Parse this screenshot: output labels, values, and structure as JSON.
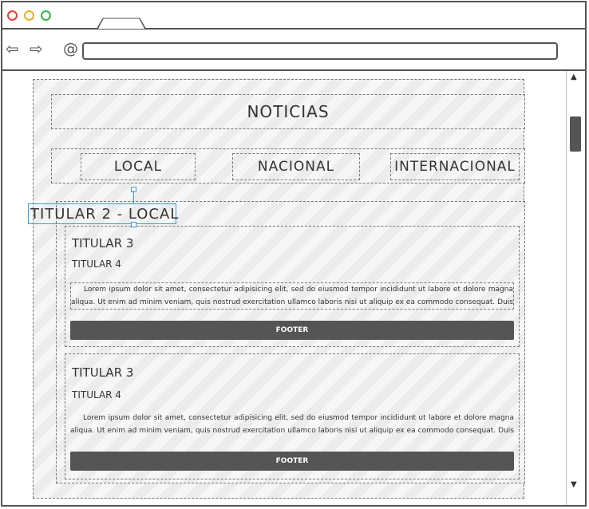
{
  "browser": {
    "dots": [
      "close-dot",
      "minimize-dot",
      "maximize-dot"
    ],
    "dot_colors": [
      "#e8413a",
      "#e6b020",
      "#3bb54a"
    ],
    "nav_back": "⇦",
    "nav_forward": "⇨",
    "reload": "@"
  },
  "page": {
    "header": "NOTICIAS",
    "nav": [
      "LOCAL",
      "NACIONAL",
      "INTERNACIONAL"
    ],
    "section_title": "TITULAR 2 - LOCAL",
    "articles": [
      {
        "h3": "TITULAR 3",
        "h4": "TITULAR 4",
        "paragraph": "Lorem ipsum dolor sit amet, consectetur adipisicing elit, sed do eiusmod tempor incididunt ut labore et dolore magna aliqua. Ut enim ad minim veniam, quis nostrud exercitation ullamco laboris nisi ut aliquip ex ea commodo consequat. Duis aute irure dolor in reprehenderit in voluptate velit esse cillum dolore eu fugiat nulla pariatur.",
        "footer": "FOOTER"
      },
      {
        "h3": "TITULAR 3",
        "h4": "TITULAR 4",
        "paragraph": "Lorem ipsum dolor sit amet, consectetur adipisicing elit, sed do eiusmod tempor incididunt ut labore et dolore magna aliqua. Ut enim ad minim veniam, quis nostrud exercitation ullamco laboris nisi ut aliquip ex ea commodo consequat. Duis aute irure dolor in reprehenderit in voluptate velit esse cillum dolore eu fugiat nulla pariatur.",
        "footer": "FOOTER"
      }
    ]
  },
  "colors": {
    "selection": "#3a9ad9",
    "footer_bg": "#555555"
  },
  "icons": {
    "scroll_up": "scroll-up-arrow-icon",
    "scroll_down": "scroll-down-arrow-icon"
  }
}
